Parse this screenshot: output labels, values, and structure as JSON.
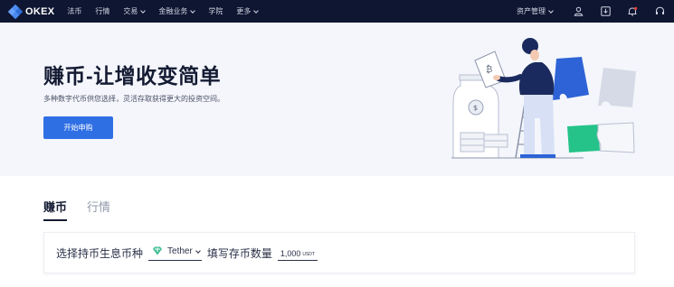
{
  "nav": {
    "logo": "OKEX",
    "items": [
      {
        "label": "法币",
        "dropdown": false
      },
      {
        "label": "行情",
        "dropdown": false
      },
      {
        "label": "交易",
        "dropdown": true
      },
      {
        "label": "金融业务",
        "dropdown": true
      },
      {
        "label": "学院",
        "dropdown": false
      },
      {
        "label": "更多",
        "dropdown": true
      }
    ],
    "assets_label": "资产管理",
    "icons": [
      "user-icon",
      "download-icon",
      "bell-icon",
      "headset-icon"
    ],
    "notification_color": "#e8413d"
  },
  "hero": {
    "title": "赚币-让增收变简单",
    "subtitle": "多种数字代币供您选择，灵活存取获得更大的投资空间。",
    "cta_label": "开始申购",
    "accent_color": "#2f6fe4"
  },
  "tabs": [
    {
      "label": "赚币",
      "active": true
    },
    {
      "label": "行情",
      "active": false
    }
  ],
  "form": {
    "coin_label": "选择持币生息币种",
    "coin_value": "Tether",
    "coin_icon": "tether-diamond-icon",
    "coin_color": "#3fbf92",
    "amount_label": "填写存币数量",
    "amount_value": "1,000",
    "amount_unit": "USDT"
  }
}
